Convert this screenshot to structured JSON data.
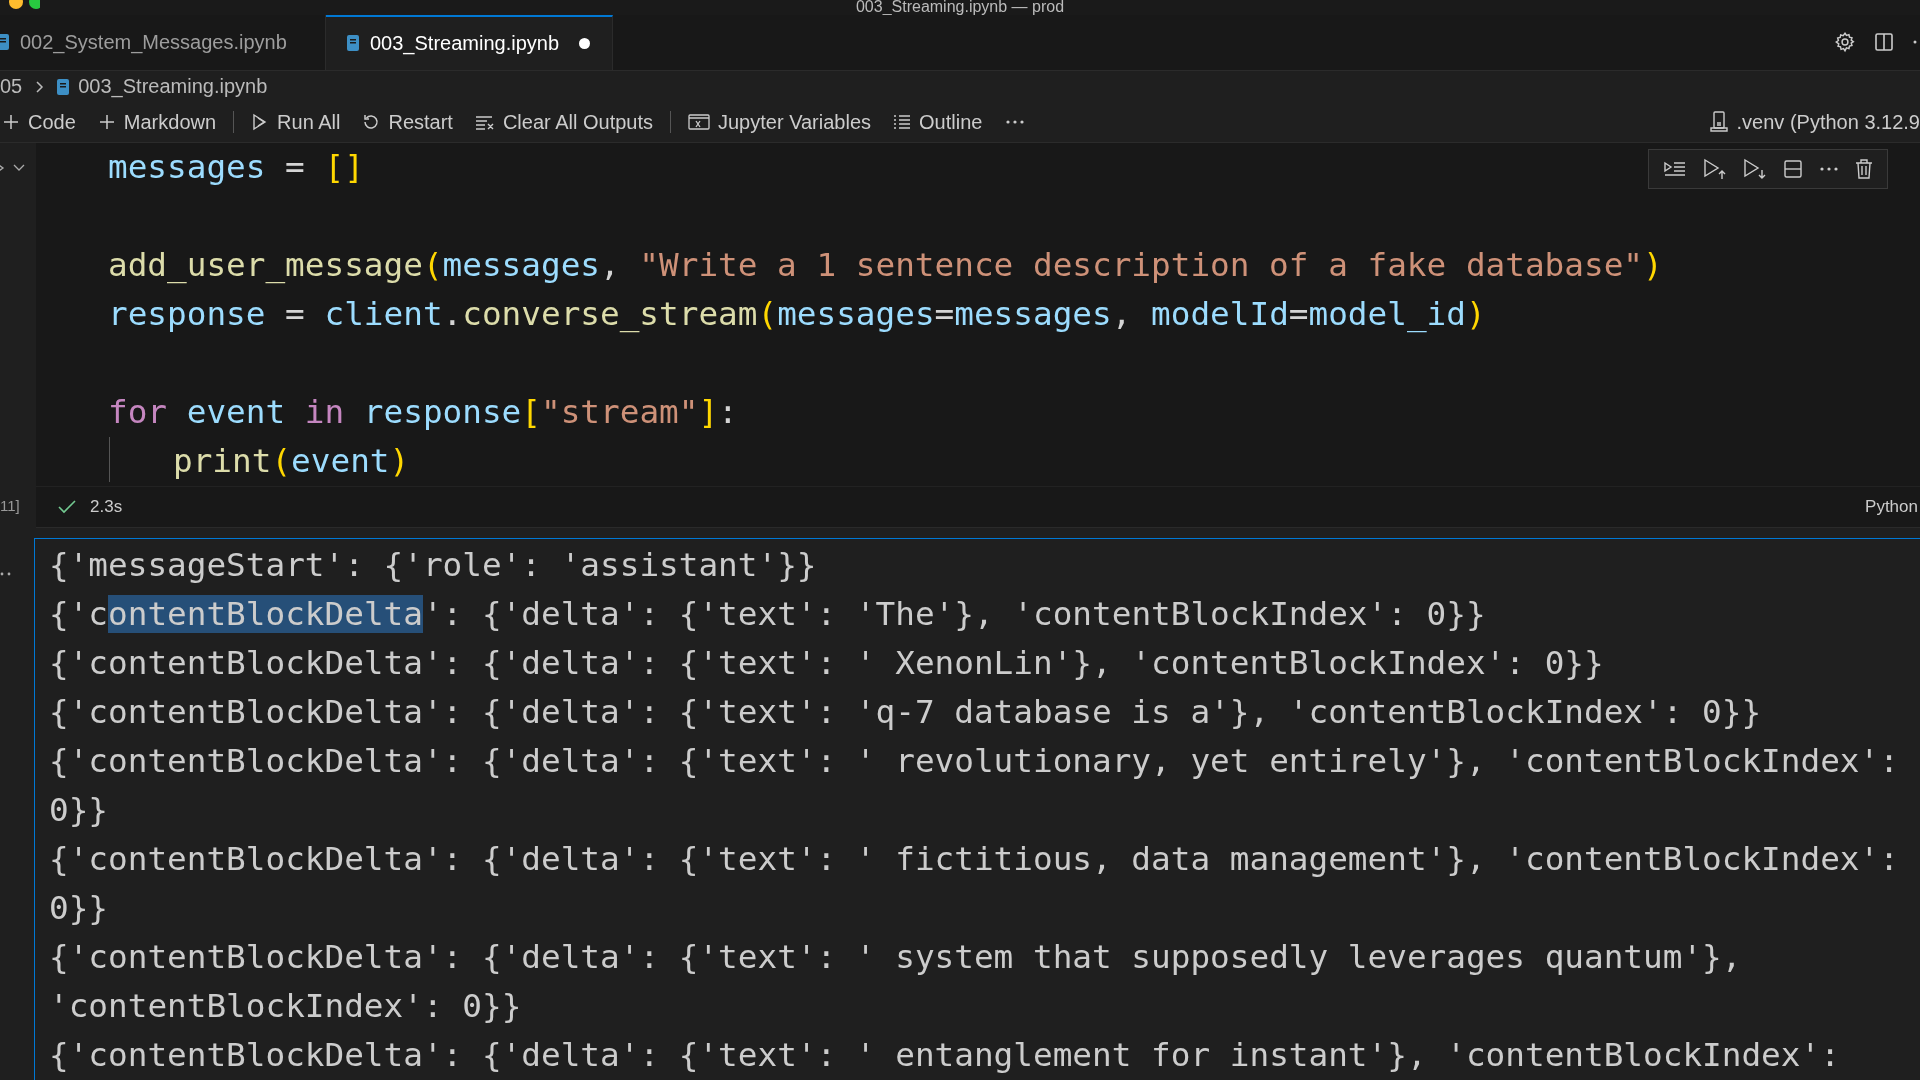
{
  "window": {
    "title": "003_Streaming.ipynb — prod"
  },
  "tabs": [
    {
      "label": "002_System_Messages.ipynb",
      "selected": false,
      "modified": false
    },
    {
      "label": "003_Streaming.ipynb",
      "selected": true,
      "modified": true
    }
  ],
  "breadcrumb": [
    {
      "label": "05",
      "kind": "folder"
    },
    {
      "label": "003_Streaming.ipynb",
      "kind": "notebook"
    }
  ],
  "toolbar": {
    "items": [
      {
        "kind": "add",
        "label": "Code"
      },
      {
        "kind": "add",
        "label": "Markdown"
      },
      {
        "kind": "separator"
      },
      {
        "kind": "run",
        "label": "Run All"
      },
      {
        "kind": "restart",
        "label": "Restart"
      },
      {
        "kind": "clear",
        "label": "Clear All Outputs"
      },
      {
        "kind": "separator"
      },
      {
        "kind": "variables",
        "label": "Jupyter Variables"
      },
      {
        "kind": "outline",
        "label": "Outline"
      },
      {
        "kind": "more"
      }
    ],
    "kernel": ".venv (Python 3.12.9"
  },
  "cell": {
    "execution_count": "11]",
    "duration": "2.3s",
    "succeeded": true,
    "language": "Python",
    "lines": [
      {
        "kind": "code",
        "indent": false,
        "tokens": [
          {
            "text": "messages",
            "kind": "var"
          },
          {
            "text": " = ",
            "kind": "op"
          },
          {
            "text": "[]",
            "kind": "bracket"
          }
        ]
      },
      {
        "kind": "blank"
      },
      {
        "kind": "code",
        "indent": false,
        "tokens": [
          {
            "text": "add_user_message",
            "kind": "func"
          },
          {
            "text": "(",
            "kind": "bracket"
          },
          {
            "text": "messages",
            "kind": "var"
          },
          {
            "text": ", ",
            "kind": "op"
          },
          {
            "text": "\"Write a 1 sentence description of a fake database\"",
            "kind": "str"
          },
          {
            "text": ")",
            "kind": "bracket"
          }
        ]
      },
      {
        "kind": "code",
        "indent": false,
        "tokens": [
          {
            "text": "response",
            "kind": "var"
          },
          {
            "text": " = ",
            "kind": "op"
          },
          {
            "text": "client",
            "kind": "var"
          },
          {
            "text": ".",
            "kind": "op"
          },
          {
            "text": "converse_stream",
            "kind": "func"
          },
          {
            "text": "(",
            "kind": "bracket"
          },
          {
            "text": "messages",
            "kind": "var"
          },
          {
            "text": "=",
            "kind": "op"
          },
          {
            "text": "messages",
            "kind": "var"
          },
          {
            "text": ", ",
            "kind": "op"
          },
          {
            "text": "modelId",
            "kind": "var"
          },
          {
            "text": "=",
            "kind": "op"
          },
          {
            "text": "model_id",
            "kind": "var"
          },
          {
            "text": ")",
            "kind": "bracket"
          }
        ]
      },
      {
        "kind": "blank"
      },
      {
        "kind": "code",
        "indent": false,
        "tokens": [
          {
            "text": "for",
            "kind": "kw"
          },
          {
            "text": " event",
            "kind": "var"
          },
          {
            "text": " in",
            "kind": "kw"
          },
          {
            "text": " response",
            "kind": "var"
          },
          {
            "text": "[",
            "kind": "bracket"
          },
          {
            "text": "\"stream\"",
            "kind": "str"
          },
          {
            "text": "]",
            "kind": "bracket"
          },
          {
            "text": ":",
            "kind": "op"
          }
        ]
      },
      {
        "kind": "code",
        "indent": true,
        "tokens": [
          {
            "text": "print",
            "kind": "func"
          },
          {
            "text": "(",
            "kind": "bracket"
          },
          {
            "text": "event",
            "kind": "var"
          },
          {
            "text": ")",
            "kind": "bracket"
          }
        ]
      }
    ],
    "output": [
      {
        "segments": [
          {
            "text": "{'messageStart': {'role': 'assistant'}}",
            "selected": false
          }
        ]
      },
      {
        "segments": [
          {
            "text": "{'c",
            "selected": false
          },
          {
            "text": "ontentBlockDelta",
            "selected": true
          },
          {
            "text": "': {'delta': {'text': 'The'}, 'contentBlockIndex': 0}}",
            "selected": false
          }
        ]
      },
      {
        "segments": [
          {
            "text": "{'contentBlockDelta': {'delta': {'text': ' XenonLin'}, 'contentBlockIndex': 0}}",
            "selected": false
          }
        ]
      },
      {
        "segments": [
          {
            "text": "{'contentBlockDelta': {'delta': {'text': 'q-7 database is a'}, 'contentBlockIndex': 0}}",
            "selected": false
          }
        ]
      },
      {
        "segments": [
          {
            "text": "{'contentBlockDelta': {'delta': {'text': ' revolutionary, yet entirely'}, 'contentBlockIndex':",
            "selected": false
          }
        ]
      },
      {
        "segments": [
          {
            "text": "0}}",
            "selected": false
          }
        ]
      },
      {
        "segments": [
          {
            "text": "{'contentBlockDelta': {'delta': {'text': ' fictitious, data management'}, 'contentBlockIndex':",
            "selected": false
          }
        ]
      },
      {
        "segments": [
          {
            "text": "0}}",
            "selected": false
          }
        ]
      },
      {
        "segments": [
          {
            "text": "{'contentBlockDelta': {'delta': {'text': ' system that supposedly leverages quantum'},",
            "selected": false
          }
        ]
      },
      {
        "segments": [
          {
            "text": "'contentBlockIndex': 0}}",
            "selected": false
          }
        ]
      },
      {
        "segments": [
          {
            "text": "{'contentBlockDelta': {'delta': {'text': ' entanglement for instant'}, 'contentBlockIndex':",
            "selected": false
          }
        ]
      }
    ]
  }
}
